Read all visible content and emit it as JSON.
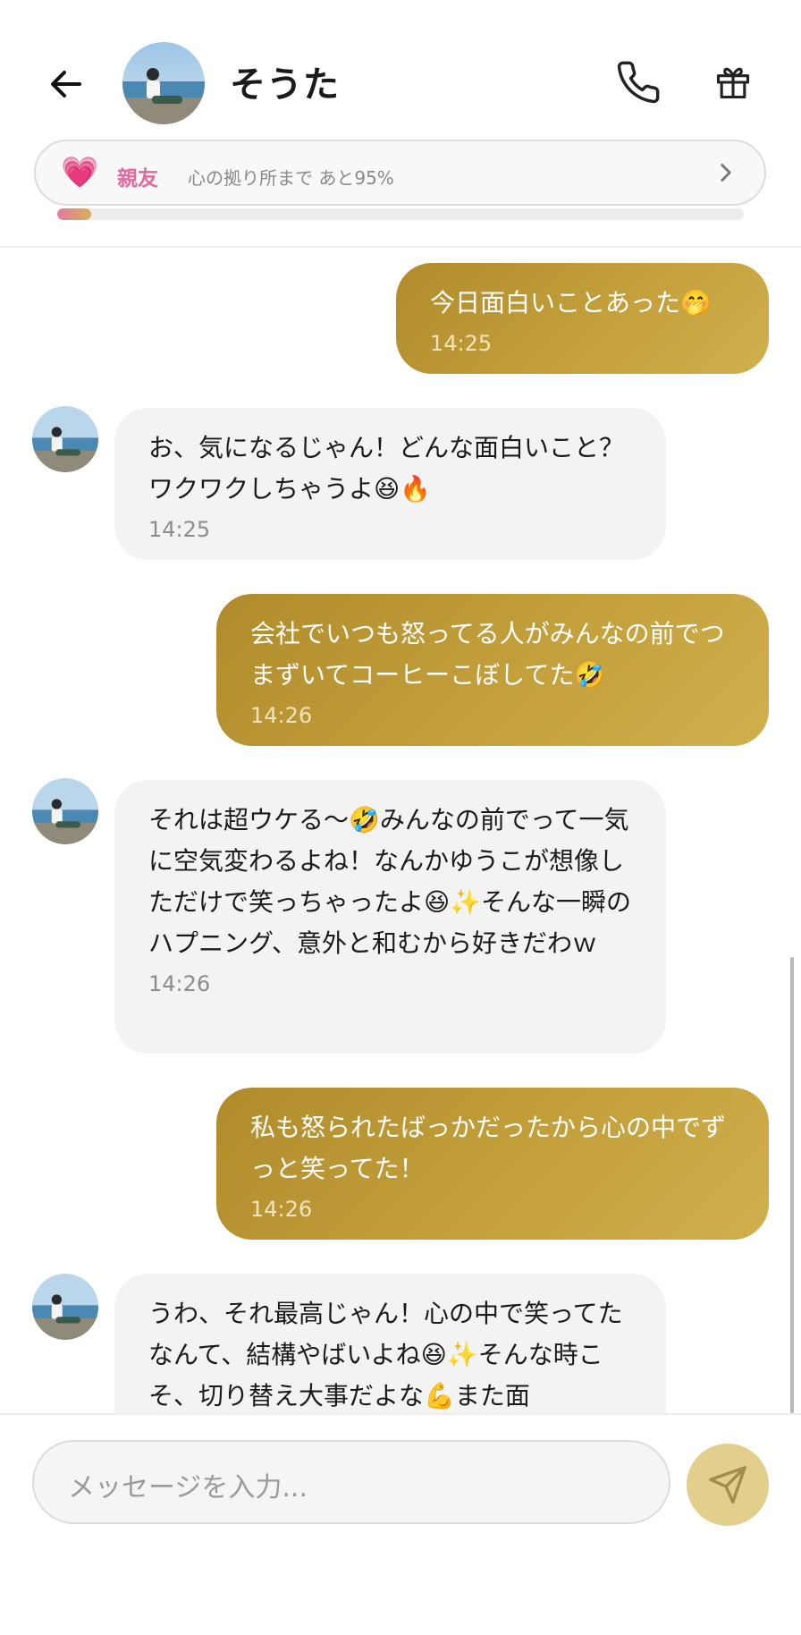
{
  "header": {
    "contact_name": "そうた"
  },
  "friendship": {
    "level_label": "親友",
    "progress_text": "心の拠り所まで あと95%",
    "progress_fraction": 0.05
  },
  "messages": [
    {
      "side": "out",
      "text": "今日面白いことあった🤭",
      "time": "14:25"
    },
    {
      "side": "in",
      "text": "お、気になるじゃん！どんな面白いこと？ワクワクしちゃうよ😆🔥",
      "time": "14:25"
    },
    {
      "side": "out",
      "text": "会社でいつも怒ってる人がみんなの前でつまずいてコーヒーこぼしてた🤣",
      "time": "14:26"
    },
    {
      "side": "in",
      "text": "それは超ウケる〜🤣みんなの前でって一気に空気変わるよね！なんかゆうこが想像しただけで笑っちゃったよ😆✨そんな一瞬のハプニング、意外と和むから好きだわｗ",
      "time": "14:26"
    },
    {
      "side": "out",
      "text": "私も怒られたばっかだったから心の中でずっと笑ってた！",
      "time": "14:26"
    },
    {
      "side": "in",
      "text": "うわ、それ最高じゃん！心の中で笑ってたなんて、結構やばいよね😆✨そんな時こそ、切り替え大事だよな💪また面"
    }
  ],
  "composer": {
    "placeholder": "メッセージを入力..."
  },
  "colors": {
    "outgoing_bubble": "#c4a03c",
    "incoming_bubble": "#f3f3f3",
    "send_button": "#e2cf8c",
    "level_label": "#e06b9e"
  },
  "icons": [
    "back-arrow-icon",
    "phone-icon",
    "gift-icon",
    "heart-icon",
    "chevron-right-icon",
    "send-icon"
  ]
}
